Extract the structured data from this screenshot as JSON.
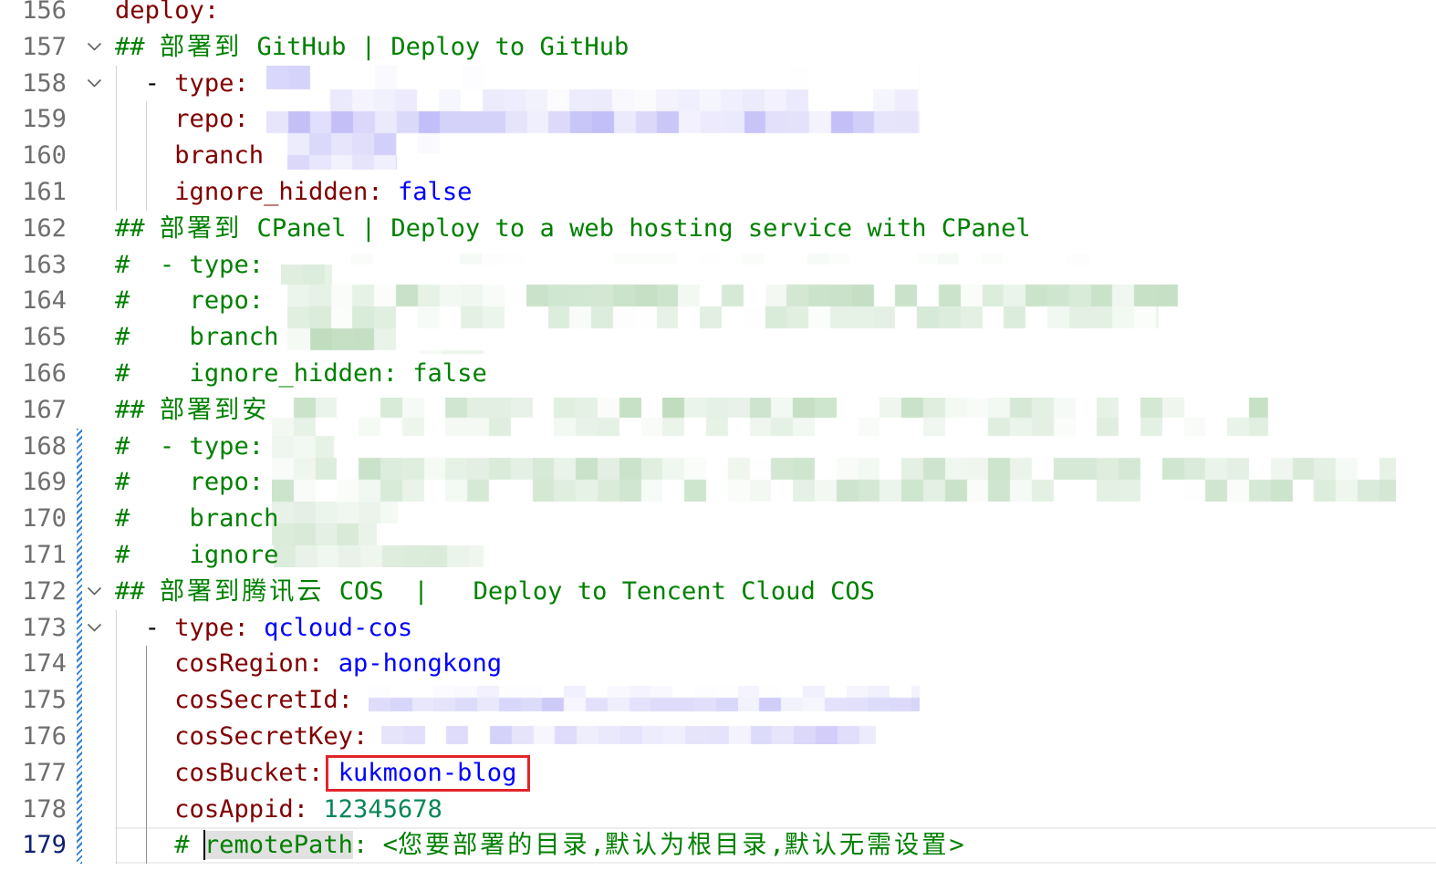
{
  "editor": {
    "colors": {
      "key": "#800000",
      "punct": "#000000",
      "string": "#0000ff",
      "boolean": "#0000ff",
      "number": "#098658",
      "comment": "#008000",
      "line_number": "#6e6e6e",
      "line_number_current": "#0b216f",
      "annotation_box": "#e3242b",
      "git_modified": "#2f7fd6"
    },
    "lines": [
      {
        "number": "156",
        "tokens": [
          {
            "text": "deploy:",
            "type": "key"
          }
        ]
      },
      {
        "number": "157",
        "fold": "chevron-down-icon",
        "tokens": [
          {
            "text": "## ",
            "type": "comment"
          },
          {
            "text": "部署到",
            "type": "comment"
          },
          {
            "text": " GitHub | Deploy to GitHub",
            "type": "comment"
          }
        ]
      },
      {
        "number": "158",
        "fold": "chevron-down-icon",
        "tokens": [
          {
            "text": "  - ",
            "type": "punct"
          },
          {
            "text": "type:",
            "type": "key"
          }
        ]
      },
      {
        "number": "159",
        "tokens": [
          {
            "text": "    repo:",
            "type": "key"
          }
        ]
      },
      {
        "number": "160",
        "tokens": [
          {
            "text": "    branch",
            "type": "key"
          }
        ]
      },
      {
        "number": "161",
        "tokens": [
          {
            "text": "    ignore_hidden: ",
            "type": "key"
          },
          {
            "text": "false",
            "type": "boolean"
          }
        ]
      },
      {
        "number": "162",
        "tokens": [
          {
            "text": "## ",
            "type": "comment"
          },
          {
            "text": "部署到",
            "type": "comment"
          },
          {
            "text": " CPanel | Deploy to a web hosting service with CPanel",
            "type": "comment"
          }
        ]
      },
      {
        "number": "163",
        "tokens": [
          {
            "text": "#  - type:",
            "type": "comment"
          }
        ]
      },
      {
        "number": "164",
        "tokens": [
          {
            "text": "#    repo:",
            "type": "comment"
          }
        ]
      },
      {
        "number": "165",
        "tokens": [
          {
            "text": "#    branch",
            "type": "comment"
          }
        ]
      },
      {
        "number": "166",
        "tokens": [
          {
            "text": "#    ignore_hidden: false",
            "type": "comment"
          }
        ]
      },
      {
        "number": "167",
        "tokens": [
          {
            "text": "## ",
            "type": "comment"
          },
          {
            "text": "部署到安",
            "type": "comment"
          }
        ]
      },
      {
        "number": "168",
        "modified": true,
        "tokens": [
          {
            "text": "#  - type:",
            "type": "comment"
          }
        ]
      },
      {
        "number": "169",
        "modified": true,
        "tokens": [
          {
            "text": "#    repo:",
            "type": "comment"
          }
        ]
      },
      {
        "number": "170",
        "modified": true,
        "tokens": [
          {
            "text": "#    branch",
            "type": "comment"
          }
        ]
      },
      {
        "number": "171",
        "modified": true,
        "tokens": [
          {
            "text": "#    ignore",
            "type": "comment"
          }
        ]
      },
      {
        "number": "172",
        "modified": true,
        "fold": "chevron-down-icon",
        "tokens": [
          {
            "text": "## ",
            "type": "comment"
          },
          {
            "text": "部署到腾讯云",
            "type": "comment"
          },
          {
            "text": " COS  |   Deploy to Tencent Cloud COS",
            "type": "comment"
          }
        ]
      },
      {
        "number": "173",
        "modified": true,
        "fold": "chevron-down-icon",
        "tokens": [
          {
            "text": "  - ",
            "type": "punct"
          },
          {
            "text": "type: ",
            "type": "key"
          },
          {
            "text": "qcloud-cos",
            "type": "string"
          }
        ]
      },
      {
        "number": "174",
        "modified": true,
        "tokens": [
          {
            "text": "    cosRegion: ",
            "type": "key"
          },
          {
            "text": "ap-hongkong",
            "type": "string"
          }
        ]
      },
      {
        "number": "175",
        "modified": true,
        "tokens": [
          {
            "text": "    cosSecretId:",
            "type": "key"
          }
        ]
      },
      {
        "number": "176",
        "modified": true,
        "tokens": [
          {
            "text": "    cosSecretKey:",
            "type": "key"
          }
        ]
      },
      {
        "number": "177",
        "modified": true,
        "tokens": [
          {
            "text": "    cosBucket: ",
            "type": "key"
          },
          {
            "text": "kukmoon-blog",
            "type": "string",
            "boxed": true
          }
        ]
      },
      {
        "number": "178",
        "modified": true,
        "tokens": [
          {
            "text": "    cosAppid: ",
            "type": "key"
          },
          {
            "text": "12345678",
            "type": "number"
          }
        ]
      },
      {
        "number": "179",
        "modified": true,
        "current": true,
        "tokens": [
          {
            "text": "    # ",
            "type": "comment"
          },
          {
            "text": "remotePath",
            "type": "comment",
            "highlighted": true
          },
          {
            "text": ": <",
            "type": "comment"
          },
          {
            "text": "您要部署的目录",
            "type": "comment"
          },
          {
            "text": ",",
            "type": "comment"
          },
          {
            "text": "默认为根目录",
            "type": "comment"
          },
          {
            "text": ",",
            "type": "comment"
          },
          {
            "text": "默认无需设置",
            "type": "comment"
          },
          {
            "text": ">",
            "type": "comment"
          }
        ]
      }
    ]
  }
}
